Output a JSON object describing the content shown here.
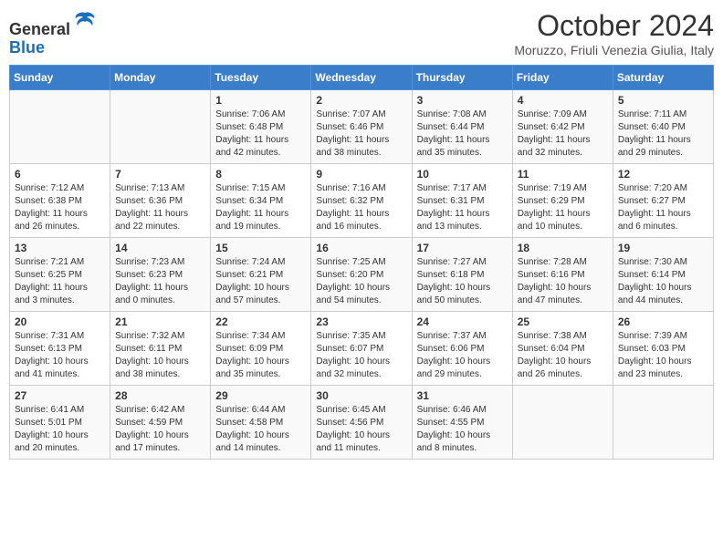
{
  "header": {
    "logo_line1": "General",
    "logo_line2": "Blue",
    "month_title": "October 2024",
    "subtitle": "Moruzzo, Friuli Venezia Giulia, Italy"
  },
  "weekdays": [
    "Sunday",
    "Monday",
    "Tuesday",
    "Wednesday",
    "Thursday",
    "Friday",
    "Saturday"
  ],
  "weeks": [
    [
      {
        "day": "",
        "info": ""
      },
      {
        "day": "",
        "info": ""
      },
      {
        "day": "1",
        "info": "Sunrise: 7:06 AM\nSunset: 6:48 PM\nDaylight: 11 hours and 42 minutes."
      },
      {
        "day": "2",
        "info": "Sunrise: 7:07 AM\nSunset: 6:46 PM\nDaylight: 11 hours and 38 minutes."
      },
      {
        "day": "3",
        "info": "Sunrise: 7:08 AM\nSunset: 6:44 PM\nDaylight: 11 hours and 35 minutes."
      },
      {
        "day": "4",
        "info": "Sunrise: 7:09 AM\nSunset: 6:42 PM\nDaylight: 11 hours and 32 minutes."
      },
      {
        "day": "5",
        "info": "Sunrise: 7:11 AM\nSunset: 6:40 PM\nDaylight: 11 hours and 29 minutes."
      }
    ],
    [
      {
        "day": "6",
        "info": "Sunrise: 7:12 AM\nSunset: 6:38 PM\nDaylight: 11 hours and 26 minutes."
      },
      {
        "day": "7",
        "info": "Sunrise: 7:13 AM\nSunset: 6:36 PM\nDaylight: 11 hours and 22 minutes."
      },
      {
        "day": "8",
        "info": "Sunrise: 7:15 AM\nSunset: 6:34 PM\nDaylight: 11 hours and 19 minutes."
      },
      {
        "day": "9",
        "info": "Sunrise: 7:16 AM\nSunset: 6:32 PM\nDaylight: 11 hours and 16 minutes."
      },
      {
        "day": "10",
        "info": "Sunrise: 7:17 AM\nSunset: 6:31 PM\nDaylight: 11 hours and 13 minutes."
      },
      {
        "day": "11",
        "info": "Sunrise: 7:19 AM\nSunset: 6:29 PM\nDaylight: 11 hours and 10 minutes."
      },
      {
        "day": "12",
        "info": "Sunrise: 7:20 AM\nSunset: 6:27 PM\nDaylight: 11 hours and 6 minutes."
      }
    ],
    [
      {
        "day": "13",
        "info": "Sunrise: 7:21 AM\nSunset: 6:25 PM\nDaylight: 11 hours and 3 minutes."
      },
      {
        "day": "14",
        "info": "Sunrise: 7:23 AM\nSunset: 6:23 PM\nDaylight: 11 hours and 0 minutes."
      },
      {
        "day": "15",
        "info": "Sunrise: 7:24 AM\nSunset: 6:21 PM\nDaylight: 10 hours and 57 minutes."
      },
      {
        "day": "16",
        "info": "Sunrise: 7:25 AM\nSunset: 6:20 PM\nDaylight: 10 hours and 54 minutes."
      },
      {
        "day": "17",
        "info": "Sunrise: 7:27 AM\nSunset: 6:18 PM\nDaylight: 10 hours and 50 minutes."
      },
      {
        "day": "18",
        "info": "Sunrise: 7:28 AM\nSunset: 6:16 PM\nDaylight: 10 hours and 47 minutes."
      },
      {
        "day": "19",
        "info": "Sunrise: 7:30 AM\nSunset: 6:14 PM\nDaylight: 10 hours and 44 minutes."
      }
    ],
    [
      {
        "day": "20",
        "info": "Sunrise: 7:31 AM\nSunset: 6:13 PM\nDaylight: 10 hours and 41 minutes."
      },
      {
        "day": "21",
        "info": "Sunrise: 7:32 AM\nSunset: 6:11 PM\nDaylight: 10 hours and 38 minutes."
      },
      {
        "day": "22",
        "info": "Sunrise: 7:34 AM\nSunset: 6:09 PM\nDaylight: 10 hours and 35 minutes."
      },
      {
        "day": "23",
        "info": "Sunrise: 7:35 AM\nSunset: 6:07 PM\nDaylight: 10 hours and 32 minutes."
      },
      {
        "day": "24",
        "info": "Sunrise: 7:37 AM\nSunset: 6:06 PM\nDaylight: 10 hours and 29 minutes."
      },
      {
        "day": "25",
        "info": "Sunrise: 7:38 AM\nSunset: 6:04 PM\nDaylight: 10 hours and 26 minutes."
      },
      {
        "day": "26",
        "info": "Sunrise: 7:39 AM\nSunset: 6:03 PM\nDaylight: 10 hours and 23 minutes."
      }
    ],
    [
      {
        "day": "27",
        "info": "Sunrise: 6:41 AM\nSunset: 5:01 PM\nDaylight: 10 hours and 20 minutes."
      },
      {
        "day": "28",
        "info": "Sunrise: 6:42 AM\nSunset: 4:59 PM\nDaylight: 10 hours and 17 minutes."
      },
      {
        "day": "29",
        "info": "Sunrise: 6:44 AM\nSunset: 4:58 PM\nDaylight: 10 hours and 14 minutes."
      },
      {
        "day": "30",
        "info": "Sunrise: 6:45 AM\nSunset: 4:56 PM\nDaylight: 10 hours and 11 minutes."
      },
      {
        "day": "31",
        "info": "Sunrise: 6:46 AM\nSunset: 4:55 PM\nDaylight: 10 hours and 8 minutes."
      },
      {
        "day": "",
        "info": ""
      },
      {
        "day": "",
        "info": ""
      }
    ]
  ]
}
